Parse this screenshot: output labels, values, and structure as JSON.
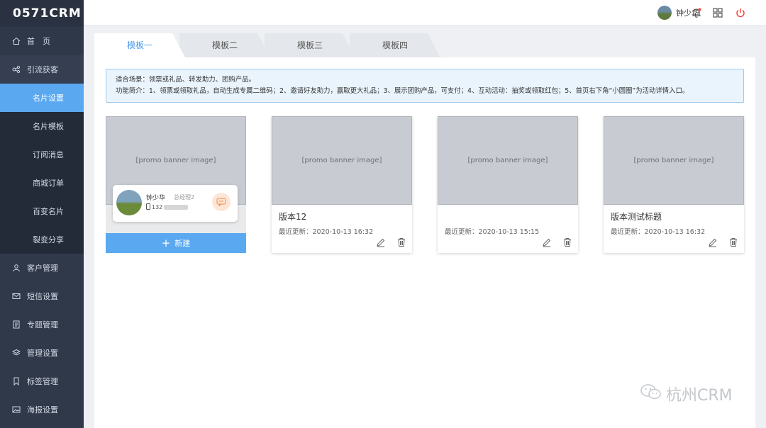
{
  "app": {
    "logo": "0571CRM"
  },
  "sidebar": {
    "home": "首　页",
    "group": "引流获客",
    "sub_items": [
      "名片设置",
      "名片模板",
      "订阅消息",
      "商城订单",
      "百变名片",
      "裂变分享"
    ],
    "items": [
      "客户管理",
      "短信设置",
      "专题管理",
      "管理设置",
      "标签管理",
      "海报设置"
    ]
  },
  "header": {
    "username": "钟少华"
  },
  "tabs": [
    "模板一",
    "模板二",
    "模板三",
    "模板四"
  ],
  "notice": {
    "line1": "适合场景：领票或礼品、转发助力、团购产品。",
    "line2": "功能简介：1、领票或领取礼品，自动生成专属二维码；2、邀请好友助力，赢取更大礼品；3、展示团购产品，可支付；4、互动活动：抽奖或领取红包；5、首页右下角“小圆圈”为活动详情入口。"
  },
  "preview": {
    "name": "钟少华",
    "role": "总经理2",
    "phone": "132",
    "new_button": "新建"
  },
  "cards": [
    {
      "title": "版本12",
      "date": "最近更新：2020-10-13 16:32"
    },
    {
      "title": "",
      "date": "最近更新：2020-10-13 15:15"
    },
    {
      "title": "版本测试标题",
      "date": "最近更新：2020-10-13 16:32"
    }
  ],
  "watermark": "杭州CRM",
  "colors": {
    "accent": "#5aa8f0",
    "sidebar": "#30394a",
    "tab_active_text": "#4a9be8"
  }
}
